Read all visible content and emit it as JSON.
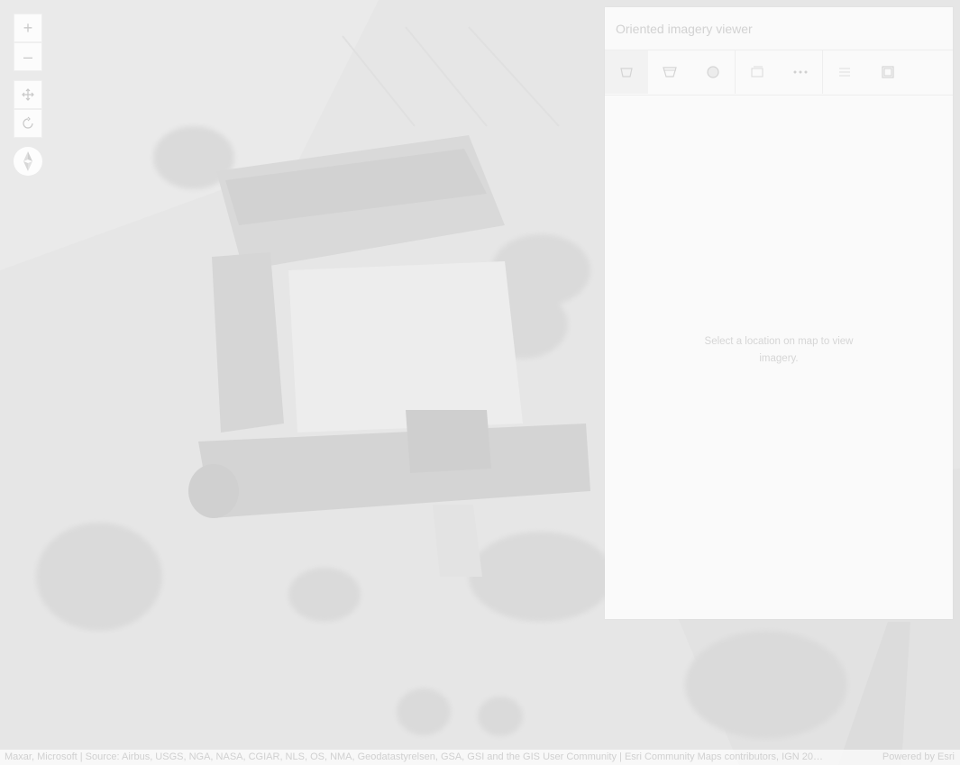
{
  "map": {
    "zoom_in_label": "+",
    "zoom_out_label": "–"
  },
  "panel": {
    "title": "Oriented imagery viewer",
    "empty_message": "Select a location on map to view imagery."
  },
  "tools": [
    {
      "icon": "footprint-icon"
    },
    {
      "icon": "camera-location-icon"
    },
    {
      "icon": "coverage-icon"
    },
    {
      "icon": "image-gallery-icon"
    },
    {
      "icon": "more-icon"
    },
    {
      "icon": "layer-list-icon"
    },
    {
      "icon": "image-enhancement-icon"
    }
  ],
  "attribution": {
    "text": "Maxar, Microsoft | Source: Airbus, USGS, NGA, NASA, CGIAR, NLS, OS, NMA, Geodatastyrelsen, GSA, GSI and the GIS User Community | Esri Community Maps contributors, IGN 20…",
    "powered_by": "Powered by Esri"
  }
}
